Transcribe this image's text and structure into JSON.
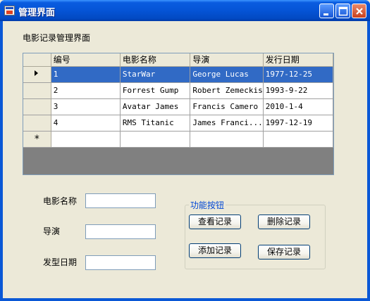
{
  "window": {
    "title": "管理界面"
  },
  "form": {
    "heading": "电影记录管理界面",
    "movie_name_label": "电影名称",
    "director_label": "导演",
    "release_date_label": "发型日期",
    "movie_name_value": "",
    "director_value": "",
    "release_date_value": ""
  },
  "grid": {
    "columns": [
      "编号",
      "电影名称",
      "导演",
      "发行日期"
    ],
    "rows": [
      [
        "1",
        "StarWar",
        "George Lucas",
        "1977-12-25"
      ],
      [
        "2",
        "Forrest Gump",
        "Robert Zemeckis",
        "1993-9-22"
      ],
      [
        "3",
        "Avatar James",
        "Francis Camero",
        "2010-1-4"
      ],
      [
        "4",
        "RMS Titanic",
        "James Franci...",
        "1997-12-19"
      ]
    ],
    "selected_row": 0,
    "new_row_marker": "*"
  },
  "actions": {
    "group_title": "功能按钮",
    "view_label": "查看记录",
    "delete_label": "删除记录",
    "add_label": "添加记录",
    "save_label": "保存记录"
  },
  "colors": {
    "titlebar": "#0554d6",
    "selection": "#316ac5",
    "group_title": "#0046d5"
  }
}
